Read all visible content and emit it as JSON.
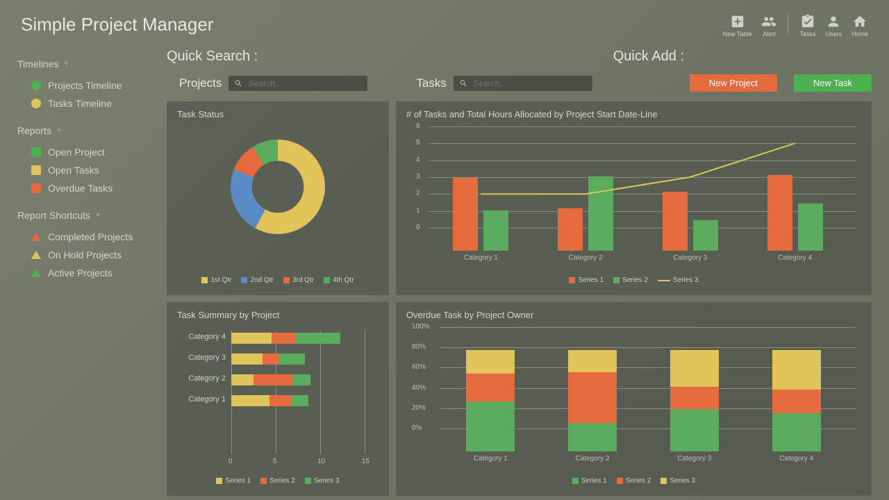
{
  "app_title": "Simple Project Manager",
  "header_icons": {
    "new_table": "New Table",
    "alert": "Alert",
    "tasks": "Tasks",
    "users": "Users",
    "home": "Home"
  },
  "sidebar": {
    "timelines": {
      "title": "Timelines",
      "items": [
        {
          "label": "Projects Timeline",
          "color": "#4caf50"
        },
        {
          "label": "Tasks Timeline",
          "color": "#e0c45a"
        }
      ]
    },
    "reports": {
      "title": "Reports",
      "items": [
        {
          "label": "Open Project",
          "color": "#4caf50"
        },
        {
          "label": "Open Tasks",
          "color": "#e0c45a"
        },
        {
          "label": "Overdue Tasks",
          "color": "#e56b3f"
        }
      ]
    },
    "shortcuts": {
      "title": "Report Shortcuts",
      "items": [
        {
          "label": "Completed Projects",
          "color": "#e56b3f"
        },
        {
          "label": "On Hold Projects",
          "color": "#e0c45a"
        },
        {
          "label": "Active Projects",
          "color": "#4caf50"
        }
      ]
    }
  },
  "toprow": {
    "quick_search_label": "Quick Search :",
    "quick_add_label": "Quick Add :",
    "projects_label": "Projects",
    "tasks_label": "Tasks",
    "search_placeholder": "Search...",
    "new_project_btn": "New Project",
    "new_task_btn": "New Task"
  },
  "cards": {
    "task_status": "Task Status",
    "tasks_hours": "# of Tasks and Total Hours Allocated by Project Start Date-Line",
    "task_summary": "Task Summary by Project",
    "overdue": "Overdue Task by Project Owner"
  },
  "legends": {
    "qtrs": [
      "1st Qtr",
      "2nd Qtr",
      "3rd Qtr",
      "4th Qtr"
    ],
    "series": [
      "Series 1",
      "Series 2",
      "Series 3"
    ]
  },
  "colors": {
    "yellow": "#e0c45a",
    "blue": "#5b8bc4",
    "orange": "#e56b3f",
    "green": "#5aab5e"
  },
  "chart_data": [
    {
      "id": "task_status",
      "type": "pie",
      "title": "Task Status",
      "categories": [
        "1st Qtr",
        "2nd Qtr",
        "3rd Qtr",
        "4th Qtr"
      ],
      "values": [
        58,
        23,
        10,
        9
      ],
      "colors": [
        "#e0c45a",
        "#5b8bc4",
        "#e56b3f",
        "#5aab5e"
      ]
    },
    {
      "id": "tasks_hours",
      "type": "bar",
      "title": "# of Tasks and Total Hours Allocated by Project Start Date-Line",
      "categories": [
        "Category 1",
        "Category 2",
        "Category 3",
        "Category 4"
      ],
      "series": [
        {
          "name": "Series 1",
          "type": "bar",
          "color": "#e56b3f",
          "values": [
            4.3,
            2.5,
            3.5,
            4.5
          ]
        },
        {
          "name": "Series 2",
          "type": "bar",
          "color": "#5aab5e",
          "values": [
            2.4,
            4.4,
            1.8,
            2.8
          ]
        },
        {
          "name": "Series 3",
          "type": "line",
          "color": "#e0c45a",
          "values": [
            2.0,
            2.0,
            3.0,
            5.0
          ]
        }
      ],
      "ylim": [
        0,
        6
      ],
      "yticks": [
        0,
        1,
        2,
        3,
        4,
        5,
        6
      ]
    },
    {
      "id": "task_summary",
      "type": "bar",
      "orientation": "horizontal",
      "stacked": true,
      "title": "Task Summary by Project",
      "categories": [
        "Category 4",
        "Category 3",
        "Category 2",
        "Category 1"
      ],
      "series": [
        {
          "name": "Series 1",
          "color": "#e0c45a",
          "values": [
            4.5,
            3.5,
            2.5,
            4.3
          ]
        },
        {
          "name": "Series 2",
          "color": "#e56b3f",
          "values": [
            2.8,
            1.8,
            4.4,
            2.4
          ]
        },
        {
          "name": "Series 3",
          "color": "#5aab5e",
          "values": [
            5.0,
            3.0,
            2.0,
            2.0
          ]
        }
      ],
      "xlim": [
        0,
        15
      ],
      "xticks": [
        0,
        5,
        10,
        15
      ]
    },
    {
      "id": "overdue",
      "type": "bar",
      "stacked": true,
      "percent": true,
      "title": "Overdue Task by Project Owner",
      "categories": [
        "Category 1",
        "Category 2",
        "Category 3",
        "Category 4"
      ],
      "series": [
        {
          "name": "Series 1",
          "color": "#5aab5e",
          "values": [
            49,
            28,
            42,
            38
          ]
        },
        {
          "name": "Series 2",
          "color": "#e56b3f",
          "values": [
            28,
            50,
            22,
            23
          ]
        },
        {
          "name": "Series 3",
          "color": "#e0c45a",
          "values": [
            23,
            22,
            36,
            39
          ]
        }
      ],
      "ylim": [
        0,
        100
      ],
      "yticks": [
        "0%",
        "20%",
        "40%",
        "60%",
        "80%",
        "100%"
      ]
    }
  ]
}
